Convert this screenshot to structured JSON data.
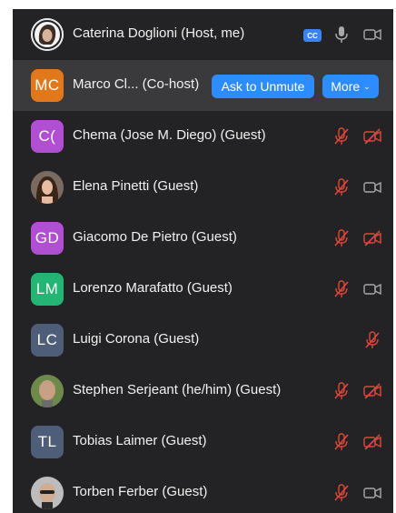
{
  "participants": [
    {
      "name": "Caterina Doglioni (Host, me)",
      "avatar_type": "photo",
      "cc_badge": "CC",
      "mic": "on",
      "video": "on"
    },
    {
      "name": "Marco Cl...  (Co-host)",
      "initials": "MC",
      "avatar_color": "#e1791c",
      "ask_unmute_label": "Ask to Unmute",
      "more_label": "More",
      "more_chevron": "⌄"
    },
    {
      "name": "Chema (Jose M. Diego) (Guest)",
      "initials": "C(",
      "avatar_color": "#b04fd1",
      "mic": "muted",
      "video": "off"
    },
    {
      "name": "Elena Pinetti (Guest)",
      "avatar_type": "photo",
      "mic": "muted",
      "video": "on"
    },
    {
      "name": "Giacomo De Pietro (Guest)",
      "initials": "GD",
      "avatar_color": "#b04fd1",
      "mic": "muted",
      "video": "off"
    },
    {
      "name": "Lorenzo Marafatto (Guest)",
      "initials": "LM",
      "avatar_color": "#22b573",
      "mic": "muted",
      "video": "on"
    },
    {
      "name": "Luigi Corona (Guest)",
      "initials": "LC",
      "avatar_color": "#4e5d78",
      "mic": "muted"
    },
    {
      "name": "Stephen Serjeant (he/him) (Guest)",
      "avatar_type": "photo",
      "mic": "muted",
      "video": "off"
    },
    {
      "name": "Tobias Laimer (Guest)",
      "initials": "TL",
      "avatar_color": "#4e5d78",
      "mic": "muted",
      "video": "off"
    },
    {
      "name": "Torben Ferber (Guest)",
      "avatar_type": "photo",
      "mic": "muted",
      "video": "on"
    }
  ],
  "colors": {
    "panel_bg": "#232325",
    "hover_row": "#3a3a3d",
    "muted_red": "#e0463c",
    "icon_grey": "#a8a8a8",
    "button_blue": "#2d8cff"
  }
}
